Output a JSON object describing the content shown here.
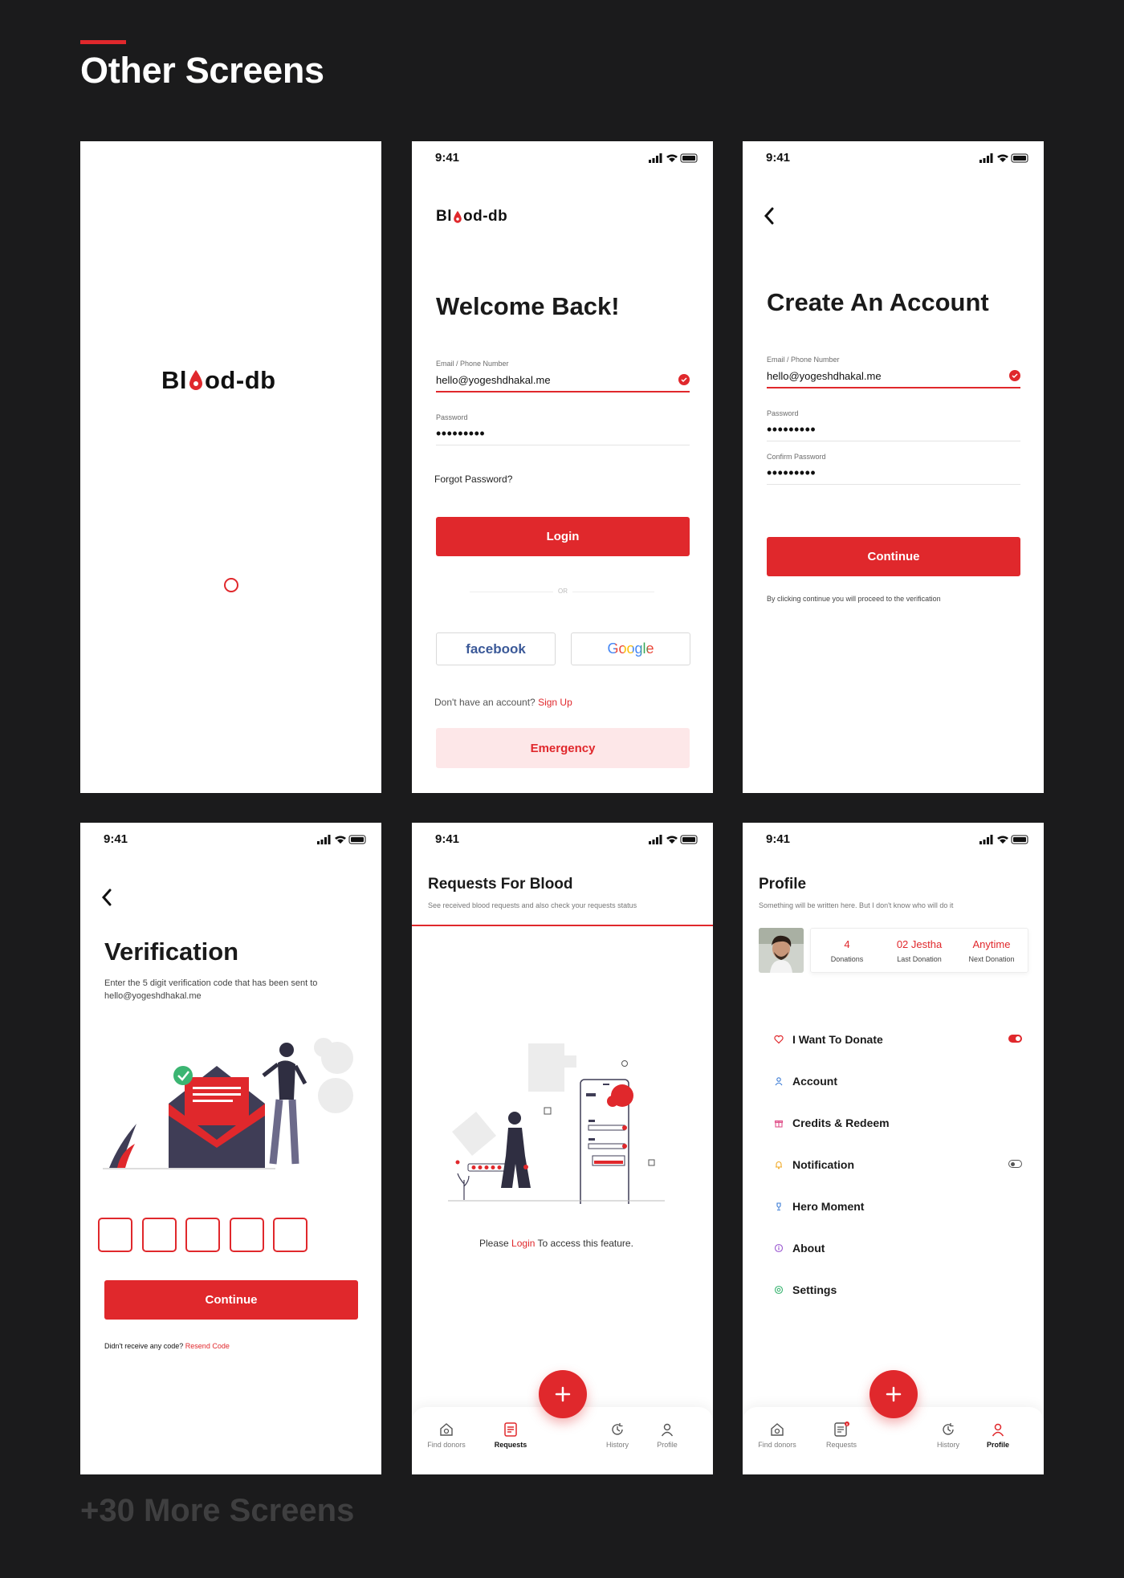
{
  "page": {
    "title": "Other Screens",
    "more_label": "+30 More Screens"
  },
  "colors": {
    "accent": "#e0282c",
    "background": "#1b1b1c",
    "pink": "#fde7e8"
  },
  "status_bar": {
    "time": "9:41"
  },
  "brand": {
    "logo_pre": "Bl",
    "logo_post": "od-db"
  },
  "login": {
    "title": "Welcome Back!",
    "email_label": "Email / Phone Number",
    "email_value": "hello@yogeshdhakal.me",
    "password_label": "Password",
    "password_value": "•••••••••",
    "forgot": "Forgot Password?",
    "login_button": "Login",
    "or": "OR",
    "facebook": "facebook",
    "google": "Google",
    "no_account": "Don't have an account?",
    "sign_up": "Sign Up",
    "emergency": "Emergency"
  },
  "signup": {
    "title": "Create An Account",
    "email_label": "Email / Phone Number",
    "email_value": "hello@yogeshdhakal.me",
    "password_label": "Password",
    "password_value": "•••••••••",
    "confirm_label": "Confirm Password",
    "confirm_value": "•••••••••",
    "continue": "Continue",
    "note": "By clicking continue you will proceed to the verification"
  },
  "verification": {
    "title": "Verification",
    "desc_line1": "Enter the 5 digit verification code that has been sent to",
    "desc_line2": "hello@yogeshdhakal.me",
    "continue": "Continue",
    "no_code": "Didn't receive any code?",
    "resend": "Resend Code"
  },
  "requests": {
    "title": "Requests For Blood",
    "subtitle": "See received blood requests and also check your requests status",
    "please": "Please",
    "login": "Login",
    "access": "To access this feature."
  },
  "profile": {
    "title": "Profile",
    "subtitle": "Something will be written here. But I don't know who will do it",
    "stats": [
      {
        "value": "4",
        "label": "Donations"
      },
      {
        "value": "02 Jestha",
        "label": "Last Donation"
      },
      {
        "value": "Anytime",
        "label": "Next Donation"
      }
    ],
    "menu": [
      {
        "label": "I Want To Donate",
        "icon": "heart-icon",
        "toggle": true
      },
      {
        "label": "Account",
        "icon": "user-icon"
      },
      {
        "label": "Credits & Redeem",
        "icon": "gift-icon"
      },
      {
        "label": "Notification",
        "icon": "bell-icon",
        "toggle": false
      },
      {
        "label": "Hero Moment",
        "icon": "trophy-icon"
      },
      {
        "label": "About",
        "icon": "info-icon"
      },
      {
        "label": "Settings",
        "icon": "settings-icon"
      }
    ]
  },
  "nav": {
    "find_donors": "Find donors",
    "requests": "Requests",
    "history": "History",
    "profile": "Profile"
  }
}
